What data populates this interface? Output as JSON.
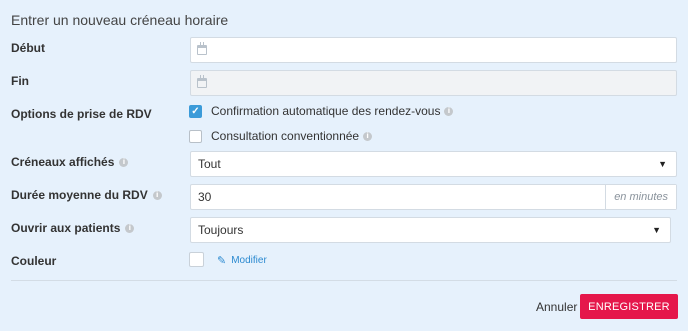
{
  "title": "Entrer un nouveau créneau horaire",
  "fields": {
    "debut": {
      "label": "Début",
      "value": ""
    },
    "fin": {
      "label": "Fin",
      "value": ""
    },
    "options": {
      "label": "Options de prise de RDV",
      "auto_confirm": {
        "label": "Confirmation automatique des rendez-vous",
        "checked": true
      },
      "conventionnee": {
        "label": "Consultation conventionnée",
        "checked": false
      }
    },
    "creneaux": {
      "label": "Créneaux affichés",
      "value": "Tout"
    },
    "duree": {
      "label": "Durée moyenne du RDV",
      "value": "30",
      "suffix": "en minutes"
    },
    "ouvrir": {
      "label": "Ouvrir aux patients",
      "value": "Toujours"
    },
    "couleur": {
      "label": "Couleur",
      "modify_label": "Modifier",
      "swatch_color": "#ffffff"
    }
  },
  "actions": {
    "cancel_label": "Annuler",
    "save_label": "ENREGISTRER"
  },
  "colors": {
    "accent": "#3b9bd9",
    "primary_button": "#e5174b",
    "link": "#2c8ad0",
    "background": "#e6f1fc"
  },
  "icons": {
    "calendar": "calendar-icon",
    "info": "info-icon",
    "caret": "caret-down-icon",
    "pencil": "pencil-icon",
    "check": "check-icon"
  }
}
